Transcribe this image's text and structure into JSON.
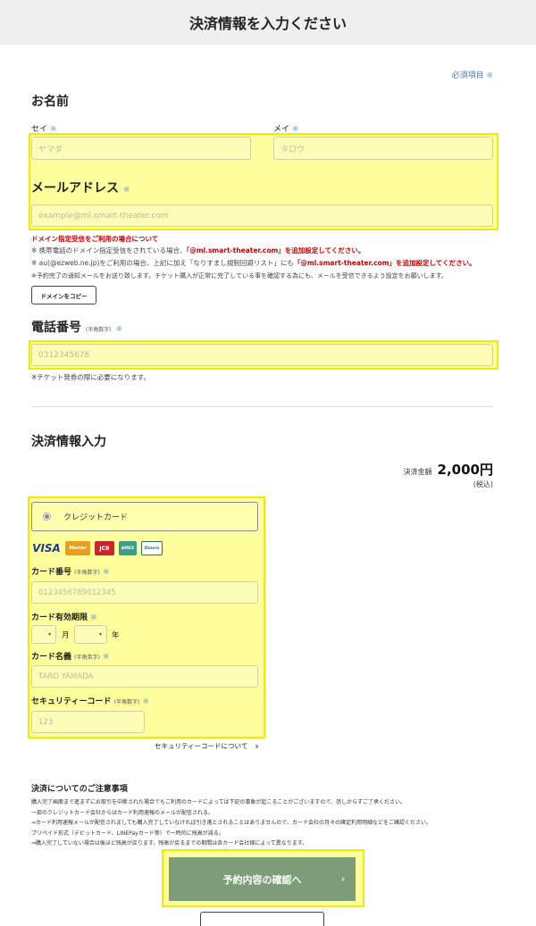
{
  "header": {
    "title": "決済情報を入力ください"
  },
  "required_note": {
    "label": "必須項目",
    "mark": "※"
  },
  "name_section": {
    "title": "お名前",
    "sei_label": "セイ",
    "mei_label": "メイ",
    "sei_placeholder": "ヤマダ",
    "mei_placeholder": "タロウ"
  },
  "email_section": {
    "title": "メールアドレス",
    "placeholder": "example@ml.smart-theater.com",
    "notice_title": "ドメイン指定受信をご利用の場合について",
    "note1_prefix": "※ 携帯電話のドメイン指定受信をされている場合、",
    "note1_domain": "「@ml.smart-theater.com」を追加設定してください。",
    "note2_prefix": "※ au(@ezweb.ne.jp)をご利用の場合、上記に加え「なりすまし規制回避リスト」にも",
    "note2_domain": "「@ml.smart-theater.com」を追加設定してください。",
    "note3": "※予約完了の通知メールをお送り致します。チケット購入が正常に完了している事を確認する為にも、メールを受信できるよう設定をお願いします。",
    "copy_button": "ドメインをコピー"
  },
  "phone_section": {
    "title": "電話番号",
    "sub": "(半角数字)",
    "placeholder": "0312345678",
    "note": "※チケット発券の際に必要になります。"
  },
  "payment_section": {
    "title": "決済情報入力",
    "amount_label": "決済金額",
    "amount": "2,000円",
    "tax": "(税込)",
    "method_label": "クレジットカード",
    "brands": [
      {
        "name": "visa-logo",
        "text": "VISA",
        "color": "#1a3f8f"
      },
      {
        "name": "mastercard-logo",
        "text": "Master",
        "color": "#e8a01c"
      },
      {
        "name": "jcb-logo",
        "text": "JCB",
        "color": "#c8252c"
      },
      {
        "name": "amex-logo",
        "text": "AMEX",
        "color": "#3c9d8b"
      },
      {
        "name": "diners-logo",
        "text": "Diners",
        "color": "#2f6f5f"
      }
    ],
    "card_number_label": "カード番号",
    "card_number_sub": "(半角数字)",
    "card_number_placeholder": "0123456789012345",
    "expiry_label": "カード有効期限",
    "month_unit": "月",
    "year_unit": "年",
    "holder_label": "カード名義",
    "holder_sub": "(半角英字)",
    "holder_placeholder": "TARO YAMADA",
    "cvc_label": "セキュリティーコード",
    "cvc_sub": "(半角数字)",
    "cvc_placeholder": "123",
    "cvc_link": "セキュリティーコードについて",
    "select_arrow": "▾",
    "link_arrow": "›"
  },
  "caution": {
    "title": "決済についてのご注意事項",
    "lines": [
      "購入完了画面まで進まずにお取引を中断された場合でもご利用のカードによっては下記の事象が起こることがございますので、恐しからずご了承ください。",
      "一部のクレジットカード会社からはカード利用速報のメールが配信される。",
      "⇒カード利用速報メールが配信されましても購入完了していなければ引き落とされることはありませんので、カード会社の月々の確定利用明細などをご確認ください。",
      "プリペイド形式（デビットカード、LINEPayカード等）で一時的に残高が減る。",
      "⇒購入完了していない場合は後ほど残高が戻ります。残高が戻るまでの期間は各カード会社様によって異なります。"
    ]
  },
  "actions": {
    "confirm_label": "予約内容の確認へ",
    "confirm_arrow": "›"
  }
}
